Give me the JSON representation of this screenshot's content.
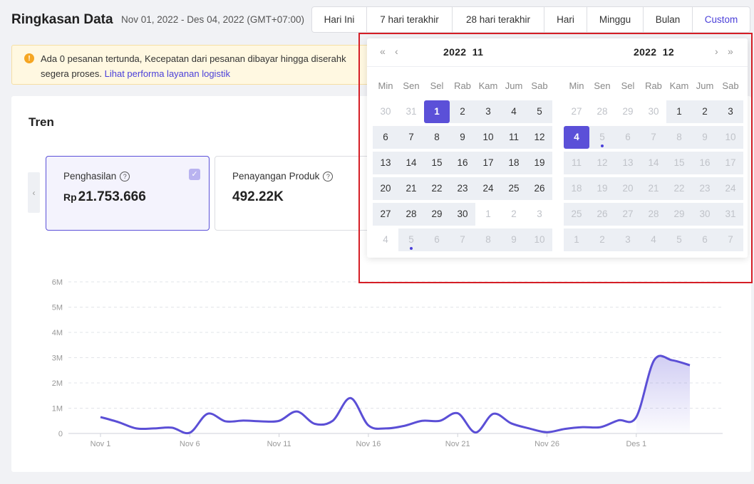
{
  "header": {
    "title": "Ringkasan Data",
    "range": "Nov 01, 2022 - Des 04, 2022 (GMT+07:00)"
  },
  "tabs": [
    {
      "label": "Hari Ini",
      "active": false
    },
    {
      "label": "7 hari terakhir",
      "active": false
    },
    {
      "label": "28 hari terakhir",
      "active": false
    },
    {
      "label": "Hari",
      "active": false
    },
    {
      "label": "Minggu",
      "active": false
    },
    {
      "label": "Bulan",
      "active": false
    },
    {
      "label": "Custom",
      "active": true
    }
  ],
  "notice": {
    "text1": "Ada 0 pesanan tertunda, Kecepatan dari pesanan dibayar hingga diserahk",
    "text2": "segera proses.",
    "link": "Lihat performa layanan logistik",
    "icon": "warning-icon"
  },
  "trend": {
    "title": "Tren",
    "metrics": [
      {
        "label": "Penghasilan",
        "currency": "Rp",
        "value": "21.753.666",
        "selected": true
      },
      {
        "label": "Penayangan Produk",
        "currency": "",
        "value": "492.22K",
        "selected": false
      }
    ]
  },
  "calendar": {
    "left": {
      "year": "2022",
      "month": "11"
    },
    "right": {
      "year": "2022",
      "month": "12"
    },
    "weekdays": [
      "Min",
      "Sen",
      "Sel",
      "Rab",
      "Kam",
      "Jum",
      "Sab"
    ],
    "left_days": [
      [
        "30",
        "31",
        "1",
        "2",
        "3",
        "4",
        "5"
      ],
      [
        "6",
        "7",
        "8",
        "9",
        "10",
        "11",
        "12"
      ],
      [
        "13",
        "14",
        "15",
        "16",
        "17",
        "18",
        "19"
      ],
      [
        "20",
        "21",
        "22",
        "23",
        "24",
        "25",
        "26"
      ],
      [
        "27",
        "28",
        "29",
        "30",
        "1",
        "2",
        "3"
      ],
      [
        "4",
        "5",
        "6",
        "7",
        "8",
        "9",
        "10"
      ]
    ],
    "right_days": [
      [
        "27",
        "28",
        "29",
        "30",
        "1",
        "2",
        "3"
      ],
      [
        "4",
        "5",
        "6",
        "7",
        "8",
        "9",
        "10"
      ],
      [
        "11",
        "12",
        "13",
        "14",
        "15",
        "16",
        "17"
      ],
      [
        "18",
        "19",
        "20",
        "21",
        "22",
        "23",
        "24"
      ],
      [
        "25",
        "26",
        "27",
        "28",
        "29",
        "30",
        "31"
      ],
      [
        "1",
        "2",
        "3",
        "4",
        "5",
        "6",
        "7"
      ]
    ],
    "nav": {
      "prev_year": "«",
      "prev_month": "‹",
      "next_month": "›",
      "next_year": "»"
    }
  },
  "chart_data": {
    "type": "area",
    "xlabel": "",
    "ylabel": "",
    "y_ticks": [
      "0",
      "1M",
      "2M",
      "3M",
      "4M",
      "5M",
      "6M"
    ],
    "ylim": [
      0,
      6000000
    ],
    "x_tick_labels": [
      "Nov 1",
      "Nov 6",
      "Nov 11",
      "Nov 16",
      "Nov 21",
      "Nov 26",
      "Des 1"
    ],
    "grid": true,
    "series": [
      {
        "color": "#5b4fd6",
        "x": [
          "Nov 1",
          "Nov 2",
          "Nov 3",
          "Nov 4",
          "Nov 5",
          "Nov 6",
          "Nov 7",
          "Nov 8",
          "Nov 9",
          "Nov 10",
          "Nov 11",
          "Nov 12",
          "Nov 13",
          "Nov 14",
          "Nov 15",
          "Nov 16",
          "Nov 17",
          "Nov 18",
          "Nov 19",
          "Nov 20",
          "Nov 21",
          "Nov 22",
          "Nov 23",
          "Nov 24",
          "Nov 25",
          "Nov 26",
          "Nov 27",
          "Nov 28",
          "Nov 29",
          "Nov 30",
          "Des 1",
          "Des 2",
          "Des 3",
          "Des 4"
        ],
        "values": [
          650000,
          450000,
          200000,
          200000,
          230000,
          30000,
          780000,
          480000,
          510000,
          480000,
          500000,
          870000,
          380000,
          500000,
          1400000,
          320000,
          200000,
          300000,
          500000,
          500000,
          800000,
          40000,
          780000,
          400000,
          200000,
          50000,
          180000,
          250000,
          250000,
          520000,
          650000,
          2900000,
          2900000,
          2700000
        ]
      }
    ]
  }
}
